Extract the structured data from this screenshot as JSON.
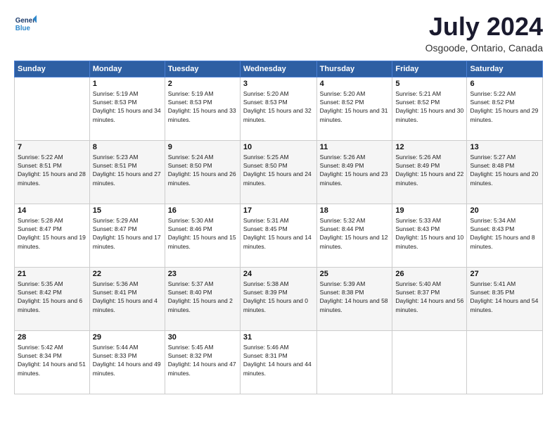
{
  "logo": {
    "line1": "General",
    "line2": "Blue"
  },
  "title": "July 2024",
  "location": "Osgoode, Ontario, Canada",
  "days_of_week": [
    "Sunday",
    "Monday",
    "Tuesday",
    "Wednesday",
    "Thursday",
    "Friday",
    "Saturday"
  ],
  "weeks": [
    [
      {
        "day": "",
        "sunrise": "",
        "sunset": "",
        "daylight": ""
      },
      {
        "day": "1",
        "sunrise": "Sunrise: 5:19 AM",
        "sunset": "Sunset: 8:53 PM",
        "daylight": "Daylight: 15 hours and 34 minutes."
      },
      {
        "day": "2",
        "sunrise": "Sunrise: 5:19 AM",
        "sunset": "Sunset: 8:53 PM",
        "daylight": "Daylight: 15 hours and 33 minutes."
      },
      {
        "day": "3",
        "sunrise": "Sunrise: 5:20 AM",
        "sunset": "Sunset: 8:53 PM",
        "daylight": "Daylight: 15 hours and 32 minutes."
      },
      {
        "day": "4",
        "sunrise": "Sunrise: 5:20 AM",
        "sunset": "Sunset: 8:52 PM",
        "daylight": "Daylight: 15 hours and 31 minutes."
      },
      {
        "day": "5",
        "sunrise": "Sunrise: 5:21 AM",
        "sunset": "Sunset: 8:52 PM",
        "daylight": "Daylight: 15 hours and 30 minutes."
      },
      {
        "day": "6",
        "sunrise": "Sunrise: 5:22 AM",
        "sunset": "Sunset: 8:52 PM",
        "daylight": "Daylight: 15 hours and 29 minutes."
      }
    ],
    [
      {
        "day": "7",
        "sunrise": "Sunrise: 5:22 AM",
        "sunset": "Sunset: 8:51 PM",
        "daylight": "Daylight: 15 hours and 28 minutes."
      },
      {
        "day": "8",
        "sunrise": "Sunrise: 5:23 AM",
        "sunset": "Sunset: 8:51 PM",
        "daylight": "Daylight: 15 hours and 27 minutes."
      },
      {
        "day": "9",
        "sunrise": "Sunrise: 5:24 AM",
        "sunset": "Sunset: 8:50 PM",
        "daylight": "Daylight: 15 hours and 26 minutes."
      },
      {
        "day": "10",
        "sunrise": "Sunrise: 5:25 AM",
        "sunset": "Sunset: 8:50 PM",
        "daylight": "Daylight: 15 hours and 24 minutes."
      },
      {
        "day": "11",
        "sunrise": "Sunrise: 5:26 AM",
        "sunset": "Sunset: 8:49 PM",
        "daylight": "Daylight: 15 hours and 23 minutes."
      },
      {
        "day": "12",
        "sunrise": "Sunrise: 5:26 AM",
        "sunset": "Sunset: 8:49 PM",
        "daylight": "Daylight: 15 hours and 22 minutes."
      },
      {
        "day": "13",
        "sunrise": "Sunrise: 5:27 AM",
        "sunset": "Sunset: 8:48 PM",
        "daylight": "Daylight: 15 hours and 20 minutes."
      }
    ],
    [
      {
        "day": "14",
        "sunrise": "Sunrise: 5:28 AM",
        "sunset": "Sunset: 8:47 PM",
        "daylight": "Daylight: 15 hours and 19 minutes."
      },
      {
        "day": "15",
        "sunrise": "Sunrise: 5:29 AM",
        "sunset": "Sunset: 8:47 PM",
        "daylight": "Daylight: 15 hours and 17 minutes."
      },
      {
        "day": "16",
        "sunrise": "Sunrise: 5:30 AM",
        "sunset": "Sunset: 8:46 PM",
        "daylight": "Daylight: 15 hours and 15 minutes."
      },
      {
        "day": "17",
        "sunrise": "Sunrise: 5:31 AM",
        "sunset": "Sunset: 8:45 PM",
        "daylight": "Daylight: 15 hours and 14 minutes."
      },
      {
        "day": "18",
        "sunrise": "Sunrise: 5:32 AM",
        "sunset": "Sunset: 8:44 PM",
        "daylight": "Daylight: 15 hours and 12 minutes."
      },
      {
        "day": "19",
        "sunrise": "Sunrise: 5:33 AM",
        "sunset": "Sunset: 8:43 PM",
        "daylight": "Daylight: 15 hours and 10 minutes."
      },
      {
        "day": "20",
        "sunrise": "Sunrise: 5:34 AM",
        "sunset": "Sunset: 8:43 PM",
        "daylight": "Daylight: 15 hours and 8 minutes."
      }
    ],
    [
      {
        "day": "21",
        "sunrise": "Sunrise: 5:35 AM",
        "sunset": "Sunset: 8:42 PM",
        "daylight": "Daylight: 15 hours and 6 minutes."
      },
      {
        "day": "22",
        "sunrise": "Sunrise: 5:36 AM",
        "sunset": "Sunset: 8:41 PM",
        "daylight": "Daylight: 15 hours and 4 minutes."
      },
      {
        "day": "23",
        "sunrise": "Sunrise: 5:37 AM",
        "sunset": "Sunset: 8:40 PM",
        "daylight": "Daylight: 15 hours and 2 minutes."
      },
      {
        "day": "24",
        "sunrise": "Sunrise: 5:38 AM",
        "sunset": "Sunset: 8:39 PM",
        "daylight": "Daylight: 15 hours and 0 minutes."
      },
      {
        "day": "25",
        "sunrise": "Sunrise: 5:39 AM",
        "sunset": "Sunset: 8:38 PM",
        "daylight": "Daylight: 14 hours and 58 minutes."
      },
      {
        "day": "26",
        "sunrise": "Sunrise: 5:40 AM",
        "sunset": "Sunset: 8:37 PM",
        "daylight": "Daylight: 14 hours and 56 minutes."
      },
      {
        "day": "27",
        "sunrise": "Sunrise: 5:41 AM",
        "sunset": "Sunset: 8:35 PM",
        "daylight": "Daylight: 14 hours and 54 minutes."
      }
    ],
    [
      {
        "day": "28",
        "sunrise": "Sunrise: 5:42 AM",
        "sunset": "Sunset: 8:34 PM",
        "daylight": "Daylight: 14 hours and 51 minutes."
      },
      {
        "day": "29",
        "sunrise": "Sunrise: 5:44 AM",
        "sunset": "Sunset: 8:33 PM",
        "daylight": "Daylight: 14 hours and 49 minutes."
      },
      {
        "day": "30",
        "sunrise": "Sunrise: 5:45 AM",
        "sunset": "Sunset: 8:32 PM",
        "daylight": "Daylight: 14 hours and 47 minutes."
      },
      {
        "day": "31",
        "sunrise": "Sunrise: 5:46 AM",
        "sunset": "Sunset: 8:31 PM",
        "daylight": "Daylight: 14 hours and 44 minutes."
      },
      {
        "day": "",
        "sunrise": "",
        "sunset": "",
        "daylight": ""
      },
      {
        "day": "",
        "sunrise": "",
        "sunset": "",
        "daylight": ""
      },
      {
        "day": "",
        "sunrise": "",
        "sunset": "",
        "daylight": ""
      }
    ]
  ]
}
